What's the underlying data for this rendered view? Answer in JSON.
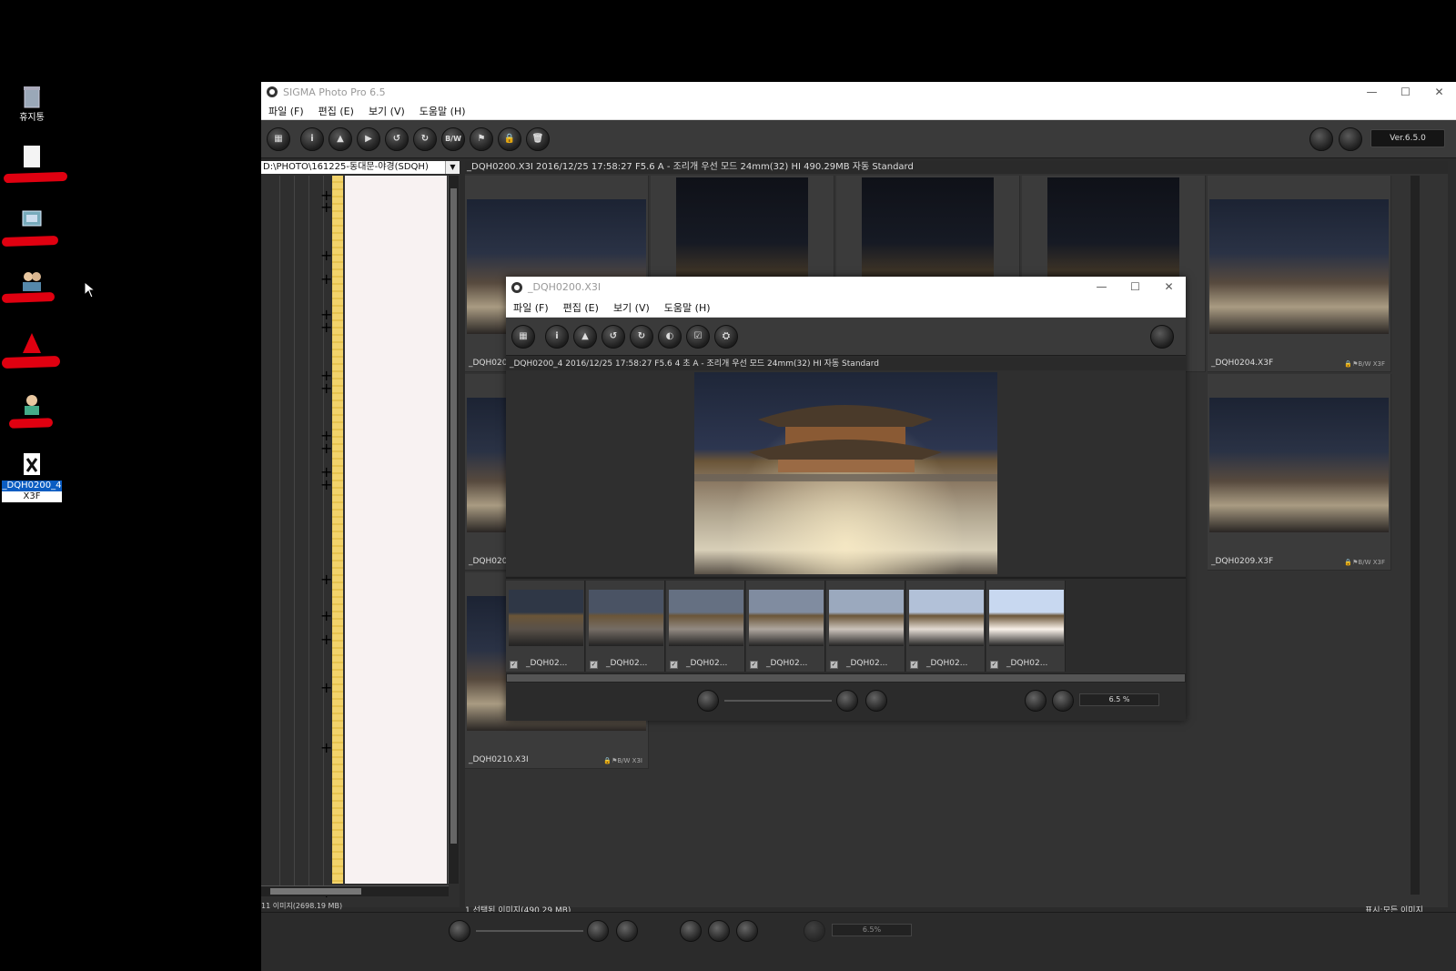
{
  "desktop": {
    "icons": [
      {
        "label": "휴지통",
        "icon": "recycle-bin-icon"
      },
      {
        "label": "",
        "icon": "file-icon"
      },
      {
        "label": "",
        "icon": "network-icon"
      },
      {
        "label": "",
        "icon": "users-icon"
      },
      {
        "label": "",
        "icon": "app-icon"
      },
      {
        "label": "",
        "icon": "user-icon"
      },
      {
        "label": "_DQH0200_4",
        "sublabel": "X3F",
        "icon": "x3f-file-icon"
      }
    ]
  },
  "main_window": {
    "title": "SIGMA Photo Pro 6.5",
    "controls": [
      "—",
      "☐",
      "✕"
    ],
    "menu": [
      "파일 (F)",
      "편집 (E)",
      "보기 (V)",
      "도움말 (H)"
    ],
    "toolbar": [
      "▦",
      "i",
      "▲",
      "▶",
      "↺",
      "↻",
      "B/W",
      "⚑",
      "🔒",
      "🗑"
    ],
    "version": "Ver.6.5.0",
    "path": "D:\\PHOTO\\161225-동대문-야경(SDQH)",
    "info": "_DQH0200.X3I 2016/12/25 17:58:27 F5.6 A - 조리개 우선 모드 24mm(32) HI 490.29MB 자동 Standard",
    "thumbnails": [
      {
        "name": "_DQH020",
        "tags": ""
      },
      {
        "name": "",
        "tags": ""
      },
      {
        "name": "",
        "tags": ""
      },
      {
        "name": "",
        "tags": ""
      },
      {
        "name": "_DQH0204.X3F",
        "tags": "🔒⚑B/W X3F"
      },
      {
        "name": "_DQH020",
        "tags": ""
      },
      {
        "name": "_DQH0209.X3F",
        "tags": "🔒⚑B/W X3F"
      },
      {
        "name": "_DQH0210.X3I",
        "tags": "🔒⚑B/W X3I"
      }
    ],
    "status_left": "11 이미지(2698.19 MB)",
    "status_mid": "1 선택된 이미지(490.29 MB)",
    "status_right": "표시:모든 이미지",
    "zoom": "6.5%"
  },
  "sub_window": {
    "title": "_DQH0200.X3I",
    "controls": [
      "—",
      "☐",
      "✕"
    ],
    "menu": [
      "파일 (F)",
      "편집 (E)",
      "보기 (V)",
      "도움말 (H)"
    ],
    "toolbar": [
      "▦",
      "i",
      "▲",
      "↺",
      "↻",
      "◐",
      "☑",
      "⛭"
    ],
    "info": "_DQH0200_4 2016/12/25 17:58:27 F5.6 4 초 A - 조리개 우선 모드 24mm(32) HI 자동 Standard",
    "filmstrip": [
      {
        "name": "_DQH02...",
        "brightness": 0.15
      },
      {
        "name": "_DQH02...",
        "brightness": 0.3
      },
      {
        "name": "_DQH02...",
        "brightness": 0.45
      },
      {
        "name": "_DQH02...",
        "brightness": 0.6
      },
      {
        "name": "_DQH02...",
        "brightness": 0.75
      },
      {
        "name": "_DQH02...",
        "brightness": 0.88
      },
      {
        "name": "_DQH02...",
        "brightness": 1.0
      }
    ],
    "zoom": "6.5 %"
  }
}
